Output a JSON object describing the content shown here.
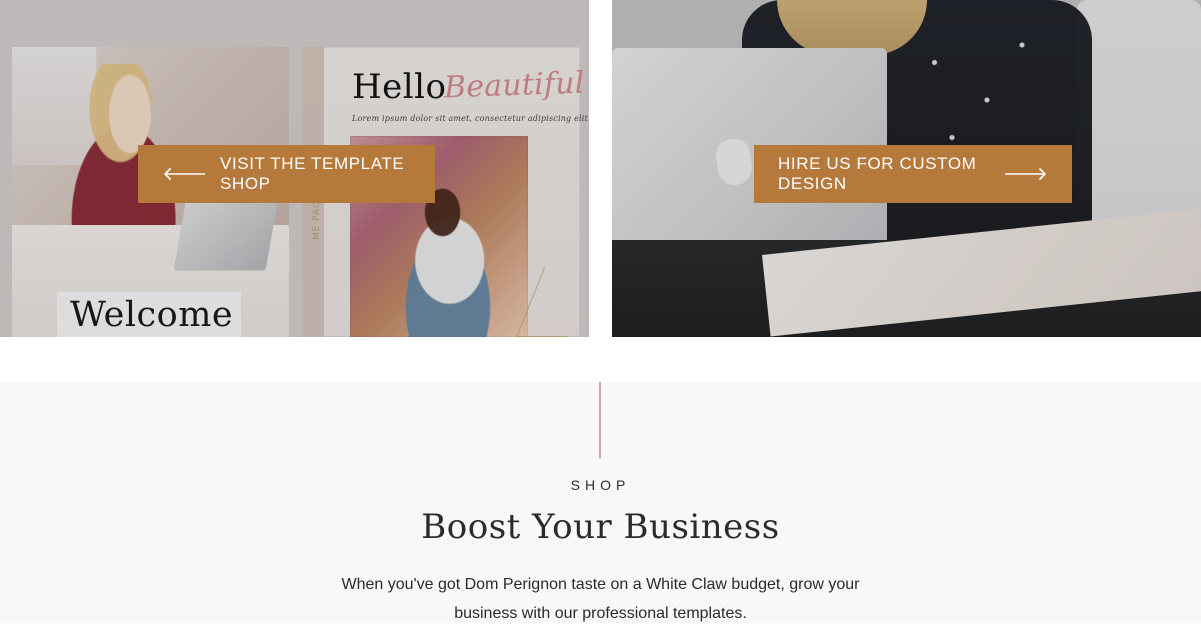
{
  "panels": {
    "left": {
      "cta_label": "VISIT THE TEMPLATE SHOP",
      "art_text": {
        "hello": "Hello",
        "beautiful": "Beautiful",
        "lorem": "Lorem ipsum dolor sit amet, consectetur adipiscing elit.",
        "welcome": "Welcome",
        "sidebar": "ME PACKET"
      }
    },
    "right": {
      "cta_label": "HIRE US FOR CUSTOM DESIGN"
    }
  },
  "section": {
    "kicker": "SHOP",
    "headline": "Boost Your Business",
    "body_lines": [
      "When you've got Dom Perignon taste on a White Claw budget, grow your",
      "business with our professional templates."
    ]
  },
  "colors": {
    "cta_bg": "#b5793c",
    "divider": "#d7a2a2",
    "bottom_bg": "#f8f8f9",
    "text": "#2b2b2b"
  },
  "icons": {
    "left_arrow": "arrow-left-icon",
    "right_arrow": "arrow-right-icon"
  }
}
